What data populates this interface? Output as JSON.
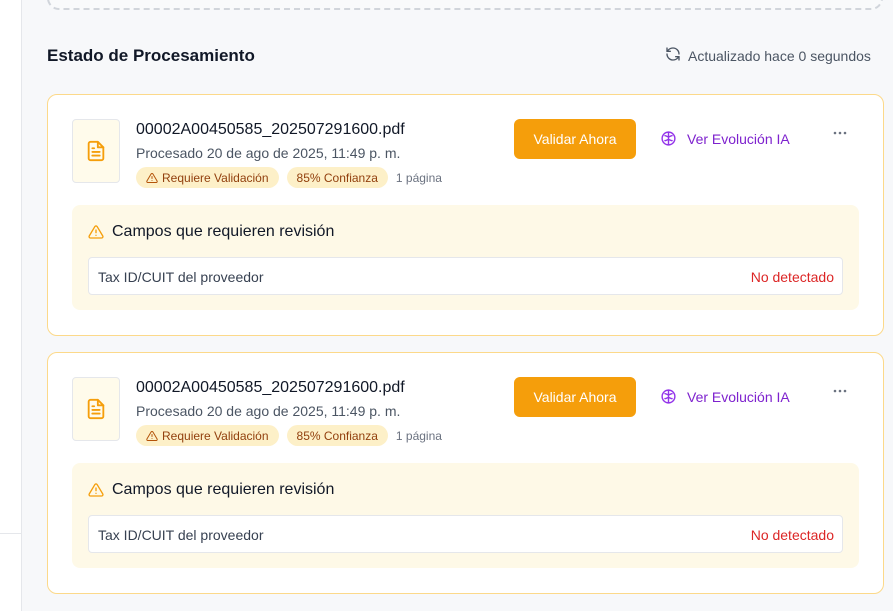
{
  "section": {
    "title": "Estado de Procesamiento",
    "refresh_label": "Actualizado hace 0 segundos",
    "refresh_icon": "refresh-icon"
  },
  "colors": {
    "accent": "#f59e0b",
    "ai_purple": "#7e22ce",
    "error_red": "#dc2626",
    "warning_bg": "#fef9e7"
  },
  "cards": [
    {
      "file_name": "00002A00450585_202507291600.pdf",
      "processed": "Procesado 20 de ago de 2025, 11:49 p. m.",
      "badge_validation": "Requiere Validación",
      "badge_confidence": "85% Confianza",
      "pages": "1 página",
      "validate_label": "Validar Ahora",
      "ai_label": "Ver Evolución IA",
      "review_title": "Campos que requieren revisión",
      "fields": [
        {
          "name": "Tax ID/CUIT del proveedor",
          "status": "No detectado"
        }
      ]
    },
    {
      "file_name": "00002A00450585_202507291600.pdf",
      "processed": "Procesado 20 de ago de 2025, 11:49 p. m.",
      "badge_validation": "Requiere Validación",
      "badge_confidence": "85% Confianza",
      "pages": "1 página",
      "validate_label": "Validar Ahora",
      "ai_label": "Ver Evolución IA",
      "review_title": "Campos que requieren revisión",
      "fields": [
        {
          "name": "Tax ID/CUIT del proveedor",
          "status": "No detectado"
        }
      ]
    }
  ]
}
